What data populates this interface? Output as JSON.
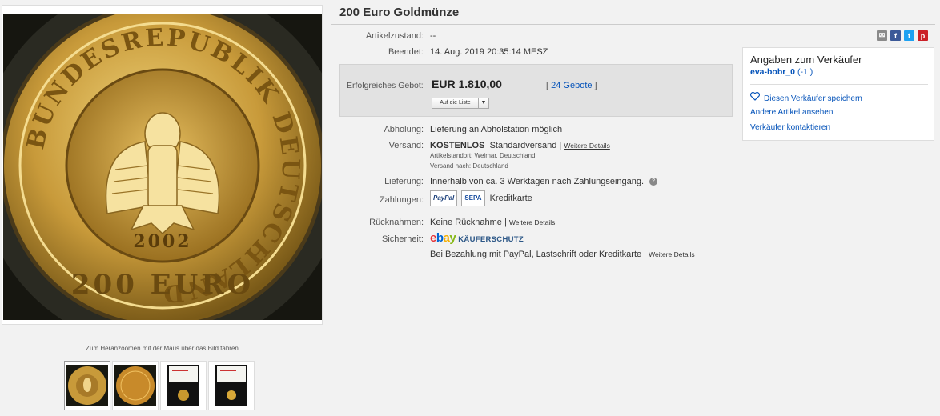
{
  "title": "200 Euro Goldmünze",
  "gallery": {
    "zoom_hint": "Zum Heranzoomen mit der Maus über das Bild fahren",
    "coin_text_ring": "BUNDESREPUBLIK DEUTSCHLAND",
    "coin_denomination": "200 EURO",
    "coin_year": "2002",
    "thumbnails": [
      "coin-front",
      "coin-back",
      "coin-case",
      "coin-case-open"
    ]
  },
  "share_icons": [
    "email-icon",
    "facebook-icon",
    "twitter-icon",
    "pinterest-icon"
  ],
  "details": {
    "condition_label": "Artikelzustand:",
    "condition_value": "--",
    "ended_label": "Beendet:",
    "ended_value": "14. Aug. 2019  20:35:14 MESZ",
    "bid_label": "Erfolgreiches Gebot:",
    "bid_price": "EUR 1.810,00",
    "bid_count_open": "[ ",
    "bid_count_link": "24 Gebote",
    "bid_count_close": " ]",
    "watch_button": "Auf die Liste",
    "pickup_label": "Abholung:",
    "pickup_value": "Lieferung an Abholstation möglich",
    "shipping_label": "Versand:",
    "shipping_free": "KOSTENLOS",
    "shipping_method": "Standardversand |",
    "shipping_more": "Weitere Details",
    "item_location": "Artikelstandort:  Weimar, Deutschland",
    "ships_to": "Versand nach:  Deutschland",
    "delivery_label": "Lieferung:",
    "delivery_value": "Innerhalb von ca. 3 Werktagen nach Zahlungseingang.",
    "payments_label": "Zahlungen:",
    "payment_paypal": "PayPal",
    "payment_sepa": "SEPA",
    "payment_card": "Kreditkarte",
    "returns_label": "Rücknahmen:",
    "returns_value": "Keine Rücknahme |",
    "returns_more": "Weitere Details",
    "security_label": "Sicherheit:",
    "ebay_logo": "ebay",
    "buyer_protection": "KÄUFERSCHUTZ",
    "security_text": "Bei Bezahlung mit PayPal, Lastschrift oder Kreditkarte |",
    "security_more": "Weitere Details"
  },
  "seller": {
    "heading": "Angaben zum Verkäufer",
    "name": "eva-bobr_0",
    "feedback": " (-1 )",
    "save_seller": "Diesen Verkäufer speichern",
    "other_items": "Andere Artikel ansehen",
    "contact": "Verkäufer kontaktieren"
  },
  "colors": {
    "link": "#0654ba",
    "gold": "#c9a24a",
    "ebay_e": "#e53238",
    "ebay_b": "#0064d2",
    "ebay_a": "#f5af02",
    "ebay_y": "#86b817"
  }
}
